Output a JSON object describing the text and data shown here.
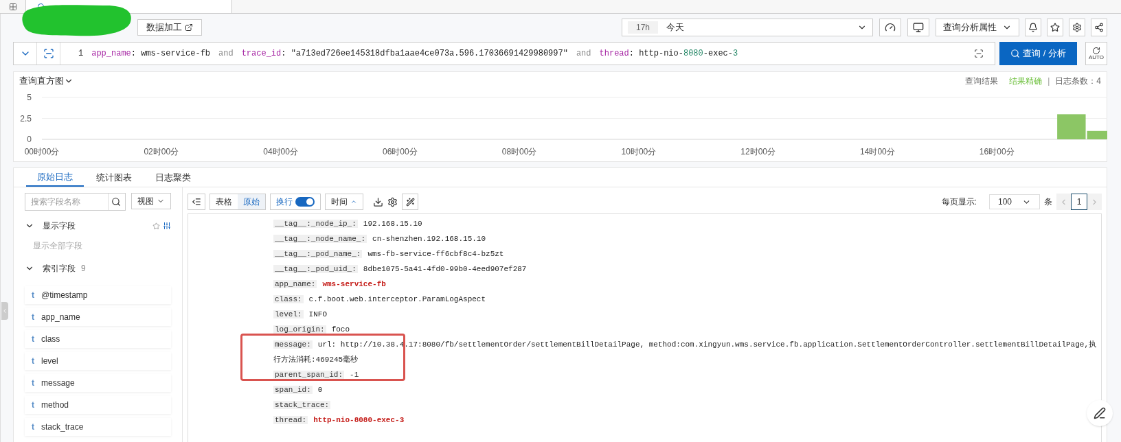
{
  "toolbar": {
    "data_button": "数据加工",
    "time_badge": "17h",
    "time_value": "今天",
    "analysis_button": "查询分析属性"
  },
  "query": {
    "line_number": "1",
    "tokens": [
      {
        "kind": "field",
        "text": "app_name"
      },
      {
        "kind": "plain",
        "text": ": wms-service-fb"
      },
      {
        "kind": "op",
        "text": "and"
      },
      {
        "kind": "field",
        "text": "trace_id"
      },
      {
        "kind": "plain",
        "text": ": \"a713ed726ee145318dfba1aae4ce073a.596.17036691429980997\""
      },
      {
        "kind": "op",
        "text": "and"
      },
      {
        "kind": "field",
        "text": "thread"
      },
      {
        "kind": "plain",
        "text": ": http-nio-"
      },
      {
        "kind": "number",
        "text": "8080"
      },
      {
        "kind": "plain",
        "text": "-exec-"
      },
      {
        "kind": "number",
        "text": "3"
      }
    ],
    "submit_button": "查询 / 分析",
    "auto_label": "AUTO"
  },
  "histogram": {
    "title": "查询直方图",
    "result_label": "查询结果",
    "accuracy": "结果精确",
    "separator": "|",
    "count": "日志条数：4",
    "chart_data": {
      "type": "bar",
      "ylim": [
        0,
        5
      ],
      "yticks": [
        0,
        2.5,
        5
      ],
      "categories": [
        "00时00分",
        null,
        null,
        null,
        "02时00分",
        null,
        null,
        null,
        "04时00分",
        null,
        null,
        null,
        "06时00分",
        null,
        null,
        null,
        "08时00分",
        null,
        null,
        null,
        "10时00分",
        null,
        null,
        null,
        "12时00分",
        null,
        null,
        null,
        "14时00分",
        null,
        null,
        null,
        "16时00分",
        null,
        null,
        null
      ],
      "values": [
        null,
        null,
        null,
        null,
        null,
        null,
        null,
        null,
        null,
        null,
        null,
        null,
        null,
        null,
        null,
        null,
        null,
        null,
        null,
        null,
        null,
        null,
        null,
        null,
        null,
        null,
        null,
        null,
        null,
        null,
        null,
        null,
        null,
        null,
        3,
        1
      ]
    }
  },
  "log_tabs": [
    {
      "label": "原始日志",
      "selected": true
    },
    {
      "label": "统计图表",
      "selected": false
    },
    {
      "label": "日志聚类",
      "selected": false
    }
  ],
  "sidebar": {
    "search_placeholder": "搜索字段名称",
    "view_button": "视图",
    "display_section": {
      "title": "显示字段",
      "expanded": true,
      "link": "显示全部字段"
    },
    "index_section": {
      "title": "索引字段",
      "count": "9",
      "expanded": true,
      "fields": [
        {
          "type": "t",
          "name": "@timestamp"
        },
        {
          "type": "t",
          "name": "app_name"
        },
        {
          "type": "t",
          "name": "class"
        },
        {
          "type": "t",
          "name": "level"
        },
        {
          "type": "t",
          "name": "message"
        },
        {
          "type": "t",
          "name": "method"
        },
        {
          "type": "t",
          "name": "stack_trace"
        }
      ]
    }
  },
  "log_toolbar": {
    "views": [
      {
        "label": "表格",
        "selected": false
      },
      {
        "label": "原始",
        "selected": true
      }
    ],
    "wrap": {
      "label": "换行",
      "on": true
    },
    "sort": "时间",
    "per_page_label": "每页显示:",
    "per_page": "100",
    "unit": "条",
    "page": "1"
  },
  "log_rows": [
    {
      "key": "__tag__:_node_ip_:",
      "value": "192.168.15.10",
      "kind": "plain"
    },
    {
      "key": "__tag__:_node_name_:",
      "value": "cn-shenzhen.192.168.15.10",
      "kind": "plain"
    },
    {
      "key": "__tag__:_pod_name_:",
      "value": "wms-fb-service-ff6cbf8c4-bz5zt",
      "kind": "plain"
    },
    {
      "key": "__tag__:_pod_uid_:",
      "value": "8dbe1075-5a41-4fd0-99b0-4eed907ef287",
      "kind": "plain"
    },
    {
      "key": "app_name:",
      "value": "wms-service-fb",
      "kind": "highlight"
    },
    {
      "key": "class:",
      "value": "c.f.boot.web.interceptor.ParamLogAspect",
      "kind": "plain"
    },
    {
      "key": "level:",
      "value": "INFO",
      "kind": "plain"
    },
    {
      "key": "log_origin:",
      "value": "foco",
      "kind": "plain"
    },
    {
      "key": "message:",
      "value": "url: http://10.38.4.17:8080/fb/settlementOrder/settlementBillDetailPage, method:com.xingyun.wms.service.fb.application.SettlementOrderController.settlementBillDetailPage,执行方法消耗:469245毫秒",
      "kind": "plain"
    },
    {
      "key": "parent_span_id:",
      "value": "-1",
      "kind": "plain"
    },
    {
      "key": "span_id:",
      "value": "0",
      "kind": "plain"
    },
    {
      "key": "stack_trace:",
      "value": "",
      "kind": "plain"
    },
    {
      "key": "thread:",
      "value": "http-nio-8080-exec-3",
      "kind": "highlight"
    }
  ]
}
